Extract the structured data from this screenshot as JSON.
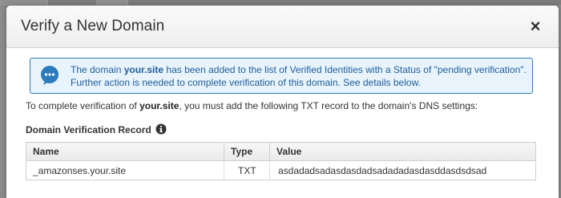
{
  "dialog": {
    "title": "Verify a New Domain",
    "close_label": "×"
  },
  "info": {
    "line1_prefix": "The domain ",
    "domain": "your.site",
    "line1_suffix": " has been added to the list of Verified Identities with a Status of \"pending verification\".",
    "line2": "Further action is needed to complete verification of this domain. See details below."
  },
  "instruction": {
    "prefix": "To complete verification of ",
    "domain": "your.site",
    "suffix": ", you must add the following TXT record to the domain's DNS settings:"
  },
  "record_section": {
    "title": "Domain Verification Record",
    "help_icon": "info-icon"
  },
  "table": {
    "headers": [
      "Name",
      "Type",
      "Value"
    ],
    "rows": [
      [
        "_amazonses.your.site",
        "TXT",
        "asdadadsadasdasdadsadadadasdasddasdsdsad"
      ]
    ]
  },
  "colors": {
    "info_border": "#2b7bbd",
    "info_background": "#e8f3fc",
    "info_text": "#1f5e9a"
  }
}
